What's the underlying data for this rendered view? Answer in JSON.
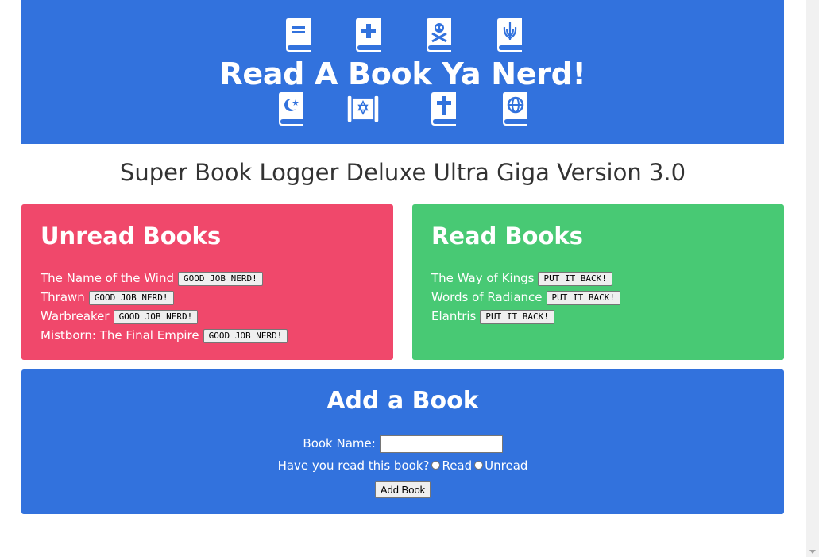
{
  "header": {
    "title": "Read A Book Ya Nerd!",
    "icons_top": [
      "book-icon",
      "bible-icon",
      "book-dead-icon",
      "book-jedi-icon"
    ],
    "icons_bottom": [
      "quran-icon",
      "torah-icon",
      "bible-icon",
      "atlas-icon"
    ]
  },
  "subtitle": "Super Book Logger Deluxe Ultra Giga Version 3.0",
  "unread": {
    "heading": "Unread Books",
    "books": [
      {
        "title": "The Name of the Wind",
        "button": "GOOD JOB NERD!"
      },
      {
        "title": "Thrawn",
        "button": "GOOD JOB NERD!"
      },
      {
        "title": "Warbreaker",
        "button": "GOOD JOB NERD!"
      },
      {
        "title": "Mistborn: The Final Empire",
        "button": "GOOD JOB NERD!"
      }
    ]
  },
  "read": {
    "heading": "Read Books",
    "books": [
      {
        "title": "The Way of Kings",
        "button": "PUT IT BACK!"
      },
      {
        "title": "Words of Radiance",
        "button": "PUT IT BACK!"
      },
      {
        "title": "Elantris",
        "button": "PUT IT BACK!"
      }
    ]
  },
  "add_form": {
    "heading": "Add a Book",
    "name_label": "Book Name:",
    "name_value": "",
    "read_question": "Have you read this book?",
    "option_read": "Read",
    "option_unread": "Unread",
    "submit_label": "Add Book"
  },
  "colors": {
    "banner": "#3272dd",
    "unread_panel": "#f0486b",
    "read_panel": "#48c974"
  }
}
